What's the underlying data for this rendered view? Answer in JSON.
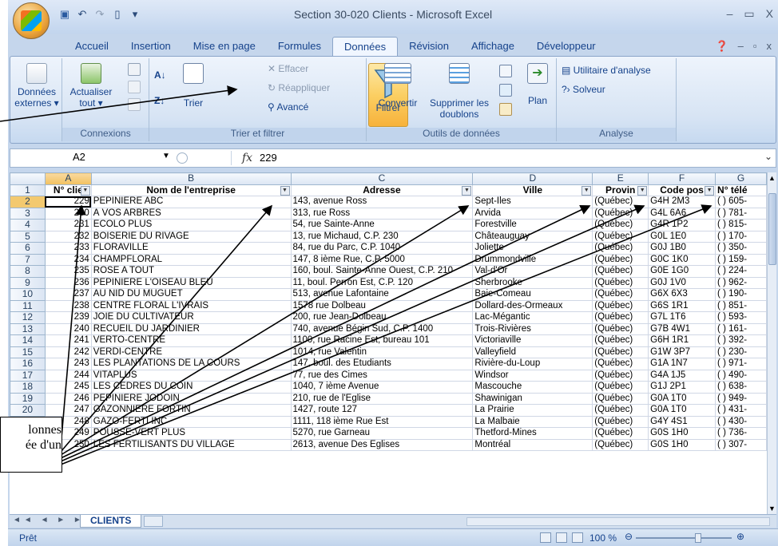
{
  "title": "Section 30-020 Clients - Microsoft Excel",
  "tabs": [
    "Accueil",
    "Insertion",
    "Mise en page",
    "Formules",
    "Données",
    "Révision",
    "Affichage",
    "Développeur"
  ],
  "active_tab": "Données",
  "ribbon": {
    "donnees_externes": "Données externes ▾",
    "actualiser": "Actualiser tout ▾",
    "connexions": "Connexions",
    "trier": "Trier",
    "filtrer": "Filtrer",
    "effacer": "Effacer",
    "reappliquer": "Réappliquer",
    "avance": "Avancé",
    "trier_filtrer": "Trier et filtrer",
    "convertir": "Convertir",
    "supprimer": "Supprimer les doublons",
    "outils": "Outils de données",
    "plan": "Plan",
    "utilitaire": "Utilitaire d'analyse",
    "solveur": "Solveur",
    "analyse": "Analyse"
  },
  "formula_bar": {
    "cell_ref": "A2",
    "fx": "fx",
    "value": "229"
  },
  "columns": [
    "A",
    "B",
    "C",
    "D",
    "E",
    "F",
    "G"
  ],
  "headers": [
    "N° clie",
    "Nom de l'entreprise",
    "Adresse",
    "Ville",
    "Provin",
    "Code pos",
    "N° télé"
  ],
  "rows": [
    {
      "n": "2",
      "id": "229",
      "nom": "PEPINIÈRE ABC",
      "adr": "143, avenue Ross",
      "ville": "Sept-Iles",
      "prov": "(Québec)",
      "cp": "G4H 2M3",
      "tel": "(  ) 605-"
    },
    {
      "n": "3",
      "id": "230",
      "nom": "À VOS ARBRES",
      "adr": "313, rue Ross",
      "ville": "Arvida",
      "prov": "(Québec)",
      "cp": "G4L 6A6",
      "tel": "(  ) 781-"
    },
    {
      "n": "4",
      "id": "231",
      "nom": "ÉCOLO PLUS",
      "adr": "54, rue Sainte-Anne",
      "ville": "Forestville",
      "prov": "(Québec)",
      "cp": "G4R 1P2",
      "tel": "(  ) 815-"
    },
    {
      "n": "5",
      "id": "232",
      "nom": "BOISERIE DU RIVAGE",
      "adr": "13, rue Michaud, C.P. 230",
      "ville": "Châteauguay",
      "prov": "(Québec)",
      "cp": "G0L 1E0",
      "tel": "(  ) 170-"
    },
    {
      "n": "6",
      "id": "233",
      "nom": "FLORAVILLE",
      "adr": "84, rue du Parc, C.P. 1040",
      "ville": "Joliette",
      "prov": "(Québec)",
      "cp": "G0J 1B0",
      "tel": "(  ) 350-"
    },
    {
      "n": "7",
      "id": "234",
      "nom": "CHAMPFLORAL",
      "adr": "147, 8 ième Rue, C.P. 5000",
      "ville": "Drummondville",
      "prov": "(Québec)",
      "cp": "G0C 1K0",
      "tel": "(  ) 159-"
    },
    {
      "n": "8",
      "id": "235",
      "nom": "ROSE A TOUT",
      "adr": "160, boul. Sainte-Anne Ouest, C.P. 210",
      "ville": "Val-d'Or",
      "prov": "(Québec)",
      "cp": "G0E 1G0",
      "tel": "(  ) 224-"
    },
    {
      "n": "9",
      "id": "236",
      "nom": "PÉPINIÈRE L'OISEAU BLEU",
      "adr": "11, boul. Perron Est, C.P. 120",
      "ville": "Sherbrooke",
      "prov": "(Québec)",
      "cp": "G0J 1V0",
      "tel": "(  ) 962-"
    },
    {
      "n": "10",
      "id": "237",
      "nom": "AU NID DU MUGUET",
      "adr": "513, avenue Lafontaine",
      "ville": "Baie-Comeau",
      "prov": "(Québec)",
      "cp": "G6X 6X3",
      "tel": "(  ) 190-"
    },
    {
      "n": "11",
      "id": "238",
      "nom": "CENTRE FLORAL L'IVRAIS",
      "adr": "1578 rue Dolbeau",
      "ville": "Dollard-des-Ormeaux",
      "prov": "(Québec)",
      "cp": "G6S 1R1",
      "tel": "(  ) 851-"
    },
    {
      "n": "12",
      "id": "239",
      "nom": "JOIE DU CULTIVATEUR",
      "adr": "200, rue Jean-Dolbeau",
      "ville": "Lac-Mégantic",
      "prov": "(Québec)",
      "cp": "G7L 1T6",
      "tel": "(  ) 593-"
    },
    {
      "n": "13",
      "id": "240",
      "nom": "RECUEIL DU JARDINIER",
      "adr": "740, avenue Bégin Sud, C.P. 1400",
      "ville": "Trois-Rivières",
      "prov": "(Québec)",
      "cp": "G7B 4W1",
      "tel": "(  ) 161-"
    },
    {
      "n": "14",
      "id": "241",
      "nom": "VERTO-CENTRE",
      "adr": "1100, rue Racine Est, bureau 101",
      "ville": "Victoriaville",
      "prov": "(Québec)",
      "cp": "G6H 1R1",
      "tel": "(  ) 392-"
    },
    {
      "n": "15",
      "id": "242",
      "nom": "VERDI-CENTRE",
      "adr": "1014, rue Valentin",
      "ville": "Valleyfield",
      "prov": "(Québec)",
      "cp": "G1W 3P7",
      "tel": "(  ) 230-"
    },
    {
      "n": "16",
      "id": "243",
      "nom": "LES PLANTATIONS DE LA COURS",
      "adr": "147, boul. des Étudiants",
      "ville": "Rivière-du-Loup",
      "prov": "(Québec)",
      "cp": "G1A 1N7",
      "tel": "(  ) 971-"
    },
    {
      "n": "17",
      "id": "244",
      "nom": "VITAPLUS",
      "adr": "77, rue des Cimes",
      "ville": "Windsor",
      "prov": "(Québec)",
      "cp": "G4A 1J5",
      "tel": "(  ) 490-"
    },
    {
      "n": "18",
      "id": "245",
      "nom": "LES CÈDRES DU COIN",
      "adr": "1040, 7 ième Avenue",
      "ville": "Mascouche",
      "prov": "(Québec)",
      "cp": "G1J 2P1",
      "tel": "(  ) 638-"
    },
    {
      "n": "19",
      "id": "246",
      "nom": "PÉPINIÈRE JODOIN",
      "adr": "210, rue de l'Église",
      "ville": "Shawinigan",
      "prov": "(Québec)",
      "cp": "G0A 1T0",
      "tel": "(  ) 949-"
    },
    {
      "n": "20",
      "id": "247",
      "nom": "GAZONNIÈRE FORTIN",
      "adr": "1427, route 127",
      "ville": "La Prairie",
      "prov": "(Québec)",
      "cp": "G0A 1T0",
      "tel": "(  ) 431-"
    },
    {
      "n": "21",
      "id": "248",
      "nom": "GAZO-FERTI INC",
      "adr": "1111, 118 ième Rue Est",
      "ville": "La Malbaie",
      "prov": "(Québec)",
      "cp": "G4Y 4S1",
      "tel": "(  ) 430-"
    },
    {
      "n": "22",
      "id": "249",
      "nom": "POUSSE-VERT PLUS",
      "adr": "5270, rue Garneau",
      "ville": "Thetford-Mines",
      "prov": "(Québec)",
      "cp": "G0S 1H0",
      "tel": "(  ) 736-"
    },
    {
      "n": "23",
      "id": "250",
      "nom": "LES FERTILISANTS DU VILLAGE",
      "adr": "2613, avenue Des Églises",
      "ville": "Montréal",
      "prov": "(Québec)",
      "cp": "G0S 1H0",
      "tel": "(  ) 307-"
    }
  ],
  "sheet_tab": "CLIENTS",
  "status": {
    "ready": "Prêt",
    "zoom": "100 %"
  },
  "callout": {
    "line1": "lonnes",
    "line2": "ée d'un"
  }
}
